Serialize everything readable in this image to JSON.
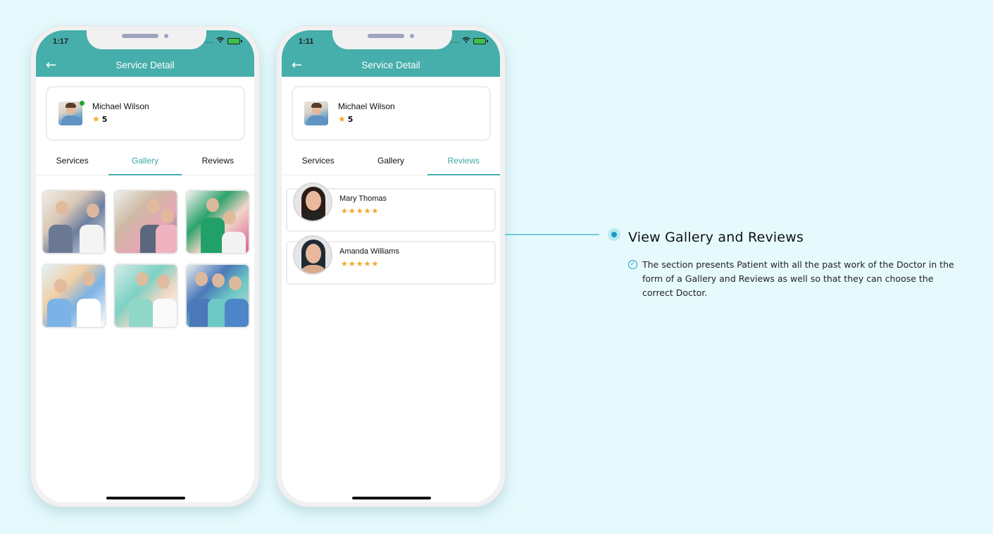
{
  "phones": [
    {
      "status": {
        "time": "1:17",
        "signal": "....",
        "battery_charging": true
      },
      "header": {
        "title": "Service Detail",
        "back_icon": "back-arrow-icon"
      },
      "doctor": {
        "name": "Michael Wilson",
        "rating": "5",
        "online": true
      },
      "tabs": [
        {
          "label": "Services",
          "active": false
        },
        {
          "label": "Gallery",
          "active": true
        },
        {
          "label": "Reviews",
          "active": false
        }
      ],
      "gallery": [
        {
          "subject": "doctor examining child with mother"
        },
        {
          "subject": "mother and daughter at consultation"
        },
        {
          "subject": "child physiotherapy exercise"
        },
        {
          "subject": "doctor with young girl and stethoscope"
        },
        {
          "subject": "nurse assisting arm therapy"
        },
        {
          "subject": "elderly patients walking rehabilitation"
        }
      ]
    },
    {
      "status": {
        "time": "1:11",
        "signal": "....",
        "battery_charging": true
      },
      "header": {
        "title": "Service Detail",
        "back_icon": "back-arrow-icon"
      },
      "doctor": {
        "name": "Michael Wilson",
        "rating": "5",
        "online": true
      },
      "tabs": [
        {
          "label": "Services",
          "active": false
        },
        {
          "label": "Gallery",
          "active": false
        },
        {
          "label": "Reviews",
          "active": true
        }
      ],
      "reviews": [
        {
          "name": "Mary Thomas",
          "stars": "★★★★★",
          "rating": 5
        },
        {
          "name": "Amanda Williams",
          "stars": "★★★★★",
          "rating": 5
        }
      ]
    }
  ],
  "feature": {
    "title": "View Gallery and Reviews",
    "description": "The section presents Patient with all the past work of the Doctor in the form of a Gallery and Reviews as well so that they can choose the correct Doctor.",
    "accent_color": "#1b9bc6"
  },
  "icons": {
    "back": "←",
    "star": "★",
    "location": "➤",
    "wifi": "⌔",
    "check": "✓"
  },
  "colors": {
    "header": "#46aeab",
    "active_tab": "#3aa8a4",
    "star": "#f5a623",
    "background": "#e6fafd"
  }
}
